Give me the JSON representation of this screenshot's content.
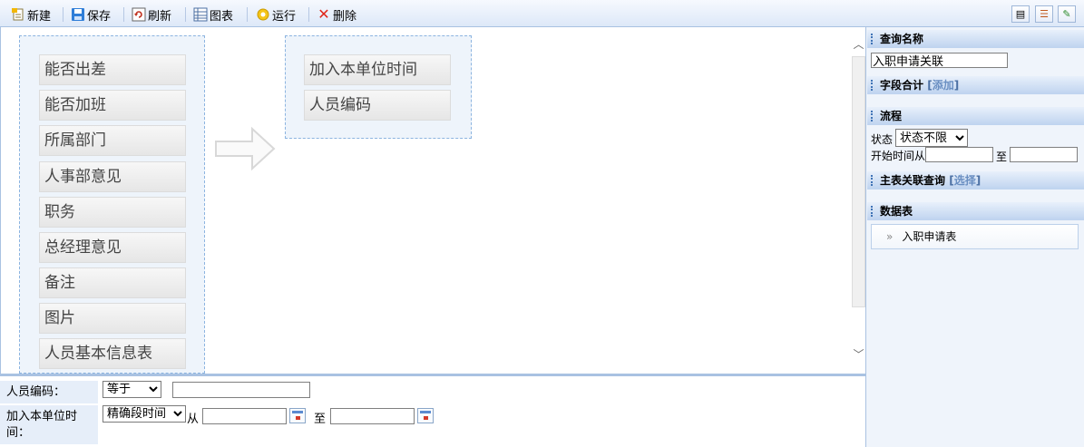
{
  "toolbar": {
    "new": "新建",
    "save": "保存",
    "refresh": "刷新",
    "chart": "图表",
    "run": "运行",
    "delete": "删除",
    "icons": {
      "new": "new-document-icon",
      "save": "save-disk-icon",
      "refresh": "refresh-icon",
      "chart": "table-chart-icon",
      "run": "run-gear-icon",
      "delete": "delete-x-icon",
      "right": [
        "document-view-icon",
        "list-view-icon",
        "link-icon"
      ]
    }
  },
  "source_fields": [
    "能否出差",
    "能否加班",
    "所属部门",
    "人事部意见",
    "职务",
    "总经理意见",
    "备注",
    "图片",
    "人员基本信息表"
  ],
  "selected_fields": [
    "加入本单位时间",
    "人员编码"
  ],
  "conditions": {
    "c1": {
      "label": "人员编码：",
      "operator": "等于",
      "value": ""
    },
    "c2": {
      "label": "加入本单位时间：",
      "operator": "精确段时间",
      "from": "从",
      "to": "至",
      "from_value": "",
      "to_value": ""
    }
  },
  "sidebar": {
    "query_name_title": "查询名称",
    "query_name": "入职申请关联",
    "field_sum_title": "字段合计",
    "field_sum_add": "添加",
    "flow_title": "流程",
    "status_label": "状态",
    "status_value": "状态不限",
    "start_time_label": "开始时间从",
    "start_to": "至",
    "master_title": "主表关联查询",
    "master_select": "选择",
    "data_table_title": "数据表",
    "data_table_item": "入职申请表",
    "data_table_bullet": "»"
  },
  "colors": {
    "accent": "#3f73b6",
    "header_bg": "#dde8f8",
    "panel_bg": "#eef4fb",
    "delete": "#e0261a"
  }
}
